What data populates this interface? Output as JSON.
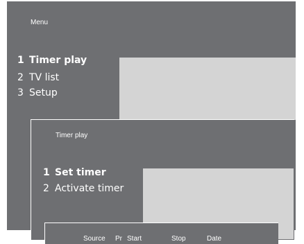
{
  "main_menu": {
    "title": "Menu",
    "items": [
      {
        "num": "1",
        "label": "Timer play"
      },
      {
        "num": "2",
        "label": "TV list"
      },
      {
        "num": "3",
        "label": "Setup"
      }
    ]
  },
  "timer_menu": {
    "title": "Timer play",
    "items": [
      {
        "num": "1",
        "label": "Set timer"
      },
      {
        "num": "2",
        "label": "Activate timer"
      }
    ]
  },
  "timer_table": {
    "headers": [
      "Source",
      "Pr",
      "Start",
      "Stop",
      "Date"
    ]
  },
  "colors": {
    "panel": "#6e6f72",
    "light": "#d4d4d4",
    "text": "#ffffff"
  }
}
